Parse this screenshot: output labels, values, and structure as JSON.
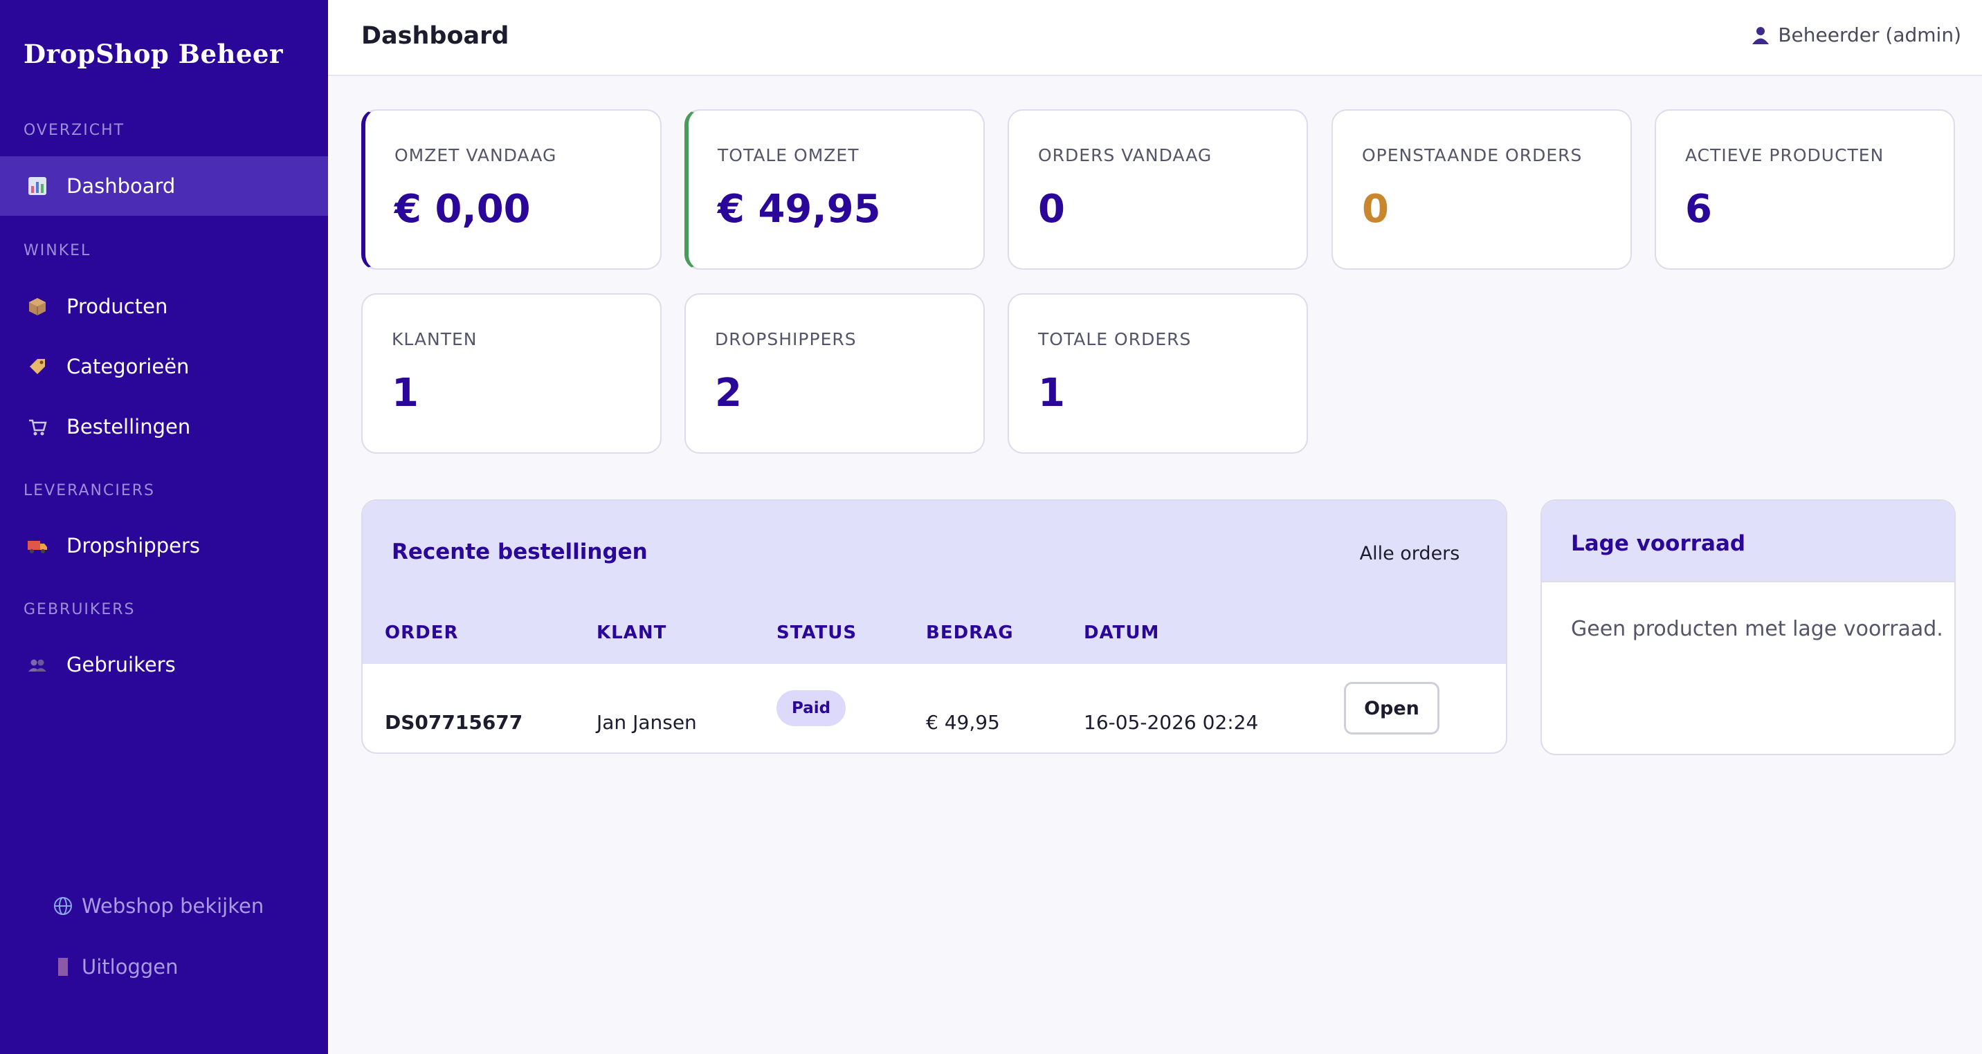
{
  "brand": "DropShop Beheer",
  "page_title": "Dashboard",
  "user": {
    "label": "Beheerder (admin)",
    "icon": "user-icon"
  },
  "nav": {
    "sections": {
      "overzicht": "OVERZICHT",
      "winkel": "WINKEL",
      "leveranciers": "LEVERANCIERS",
      "gebruikers": "GEBRUIKERS"
    },
    "items": {
      "dashboard": "Dashboard",
      "producten": "Producten",
      "categorieen": "Categorieën",
      "bestellingen": "Bestellingen",
      "dropshippers": "Dropshippers",
      "gebruikers": "Gebruikers"
    },
    "bottom": {
      "webshop": "Webshop bekijken",
      "uitloggen": "Uitloggen"
    }
  },
  "stats": {
    "omzet_vandaag": {
      "label": "OMZET VANDAAG",
      "value": "€ 0,00"
    },
    "totale_omzet": {
      "label": "TOTALE OMZET",
      "value": "€ 49,95"
    },
    "orders_vandaag": {
      "label": "ORDERS VANDAAG",
      "value": "0"
    },
    "openstaande_orders": {
      "label": "OPENSTAANDE ORDERS",
      "value": "0"
    },
    "actieve_producten": {
      "label": "ACTIEVE PRODUCTEN",
      "value": "6"
    },
    "klanten": {
      "label": "KLANTEN",
      "value": "1"
    },
    "dropshippers": {
      "label": "DROPSHIPPERS",
      "value": "2"
    },
    "totale_orders": {
      "label": "TOTALE ORDERS",
      "value": "1"
    }
  },
  "recent_orders": {
    "title": "Recente bestellingen",
    "all_button": "Alle orders",
    "columns": {
      "order": "ORDER",
      "klant": "KLANT",
      "status": "STATUS",
      "bedrag": "BEDRAG",
      "datum": "DATUM"
    },
    "rows": [
      {
        "order": "DS07715677",
        "klant": "Jan Jansen",
        "status": "Paid",
        "bedrag": "€ 49,95",
        "datum": "16-05-2026 02:24",
        "action": "Open"
      }
    ]
  },
  "low_stock": {
    "title": "Lage voorraad",
    "empty": "Geen producten met lage voorraad."
  },
  "colors": {
    "sidebar": "#2a0699",
    "sidebar_active": "#4a2cb5",
    "accent": "#2a0699",
    "warning": "#c8862e",
    "success_accent": "#4a9a5a",
    "panel_header": "#e1e0fa"
  }
}
